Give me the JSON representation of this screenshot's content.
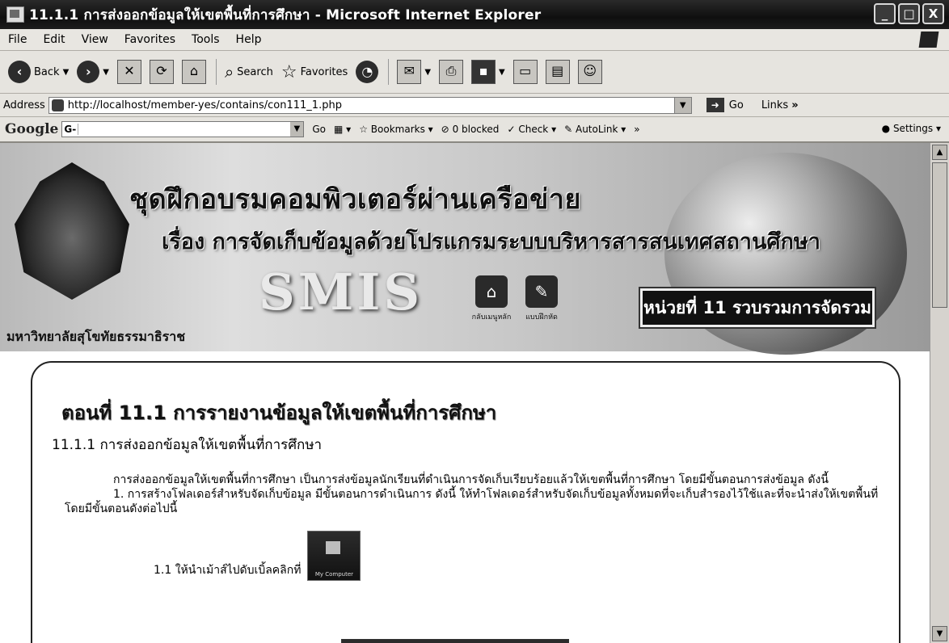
{
  "window": {
    "title": "11.1.1 การส่งออกข้อมูลให้เขตพื้นที่การศึกษา - Microsoft Internet Explorer",
    "minimize": "_",
    "maximize": "□",
    "close": "X"
  },
  "menu": [
    "File",
    "Edit",
    "View",
    "Favorites",
    "Tools",
    "Help"
  ],
  "toolbar": {
    "back": "Back",
    "search": "Search",
    "favorites": "Favorites"
  },
  "address": {
    "label": "Address",
    "url": "http://localhost/member-yes/contains/con111_1.php",
    "go": "Go",
    "links": "Links"
  },
  "google_bar": {
    "logo": "Google",
    "search_prefix": "G-",
    "go": "Go",
    "bookmarks": "Bookmarks",
    "blocked": "0 blocked",
    "check": "Check",
    "autolink": "AutoLink",
    "more": "»",
    "settings": "Settings"
  },
  "banner": {
    "heading1": "ชุดฝึกอบรมคอมพิวเตอร์ผ่านเครือข่าย",
    "heading2": "เรื่อง การจัดเก็บข้อมูลด้วยโปรแกรมระบบบริหารสารสนเทศสถานศึกษา",
    "logo_text": "SMIS",
    "home_label": "กลับเมนูหลัก",
    "exercise_label": "แบบฝึกหัด",
    "unit": "หน่วยที่ 11 รวบรวมการจัดรวม",
    "university": "มหาวิทยาลัยสุโขทัยธรรมาธิราช"
  },
  "content": {
    "section_title": "ตอนที่ 11.1 การรายงานข้อมูลให้เขตพื้นที่การศึกษา",
    "subtitle": "11.1.1 การส่งออกข้อมูลให้เขตพื้นที่การศึกษา",
    "para1": "การส่งออกข้อมูลให้เขตพื้นที่การศึกษา เป็นการส่งข้อมูลนักเรียนที่ดำเนินการจัดเก็บเรียบร้อยแล้วให้เขตพื้นที่การศึกษา โดยมีขั้นตอนการส่งข้อมูล ดังนี้",
    "para2": "1. การสร้างโฟลเดอร์สำหรับจัดเก็บข้อมูล มีขั้นตอนการดำเนินการ ดังนี้ ให้ทำโฟลเดอร์สำหรับจัดเก็บข้อมูลทั้งหมดที่จะเก็บสำรองไว้ใช้และที่จะนำส่งให้เขตพื้นที่โดยมีขั้นตอนดังต่อไปนี้",
    "step": "1.1 ให้นำเม้าส์ไปดับเบิ้ลคลิกที่",
    "icon_caption": "My Computer"
  }
}
